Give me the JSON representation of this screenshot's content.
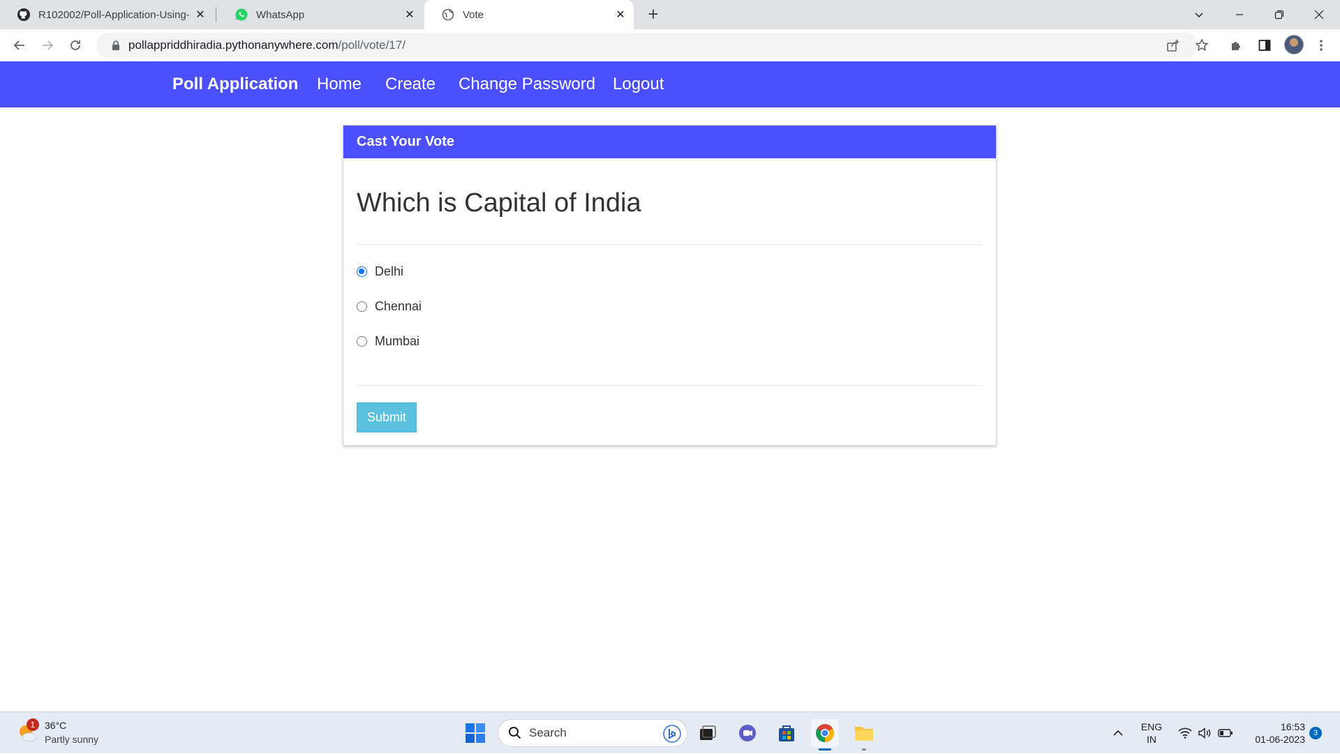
{
  "browser": {
    "tabs": [
      {
        "title": "R102002/Poll-Application-Using-",
        "icon": "github-icon",
        "active": false
      },
      {
        "title": "WhatsApp",
        "icon": "whatsapp-icon",
        "active": false
      },
      {
        "title": "Vote",
        "icon": "globe-icon",
        "active": true
      }
    ],
    "url_host": "pollappriddhiradia.pythonanywhere.com",
    "url_path": "/poll/vote/17/"
  },
  "site": {
    "brand": "Poll Application",
    "nav": [
      "Home",
      "Create",
      "Change Password",
      "Logout"
    ],
    "accent_color": "#4b4ffd"
  },
  "vote": {
    "header": "Cast Your Vote",
    "question": "Which is Capital of India",
    "choices": [
      {
        "label": "Delhi",
        "checked": true
      },
      {
        "label": "Chennai",
        "checked": false
      },
      {
        "label": "Mumbai",
        "checked": false
      }
    ],
    "submit_label": "Submit",
    "submit_color": "#5bc0de"
  },
  "taskbar": {
    "weather_temp": "36°C",
    "weather_desc": "Partly sunny",
    "weather_badge": "1",
    "search_label": "Search",
    "lang_line1": "ENG",
    "lang_line2": "IN",
    "time": "16:53",
    "date": "01-06-2023",
    "notification_count": "3"
  }
}
